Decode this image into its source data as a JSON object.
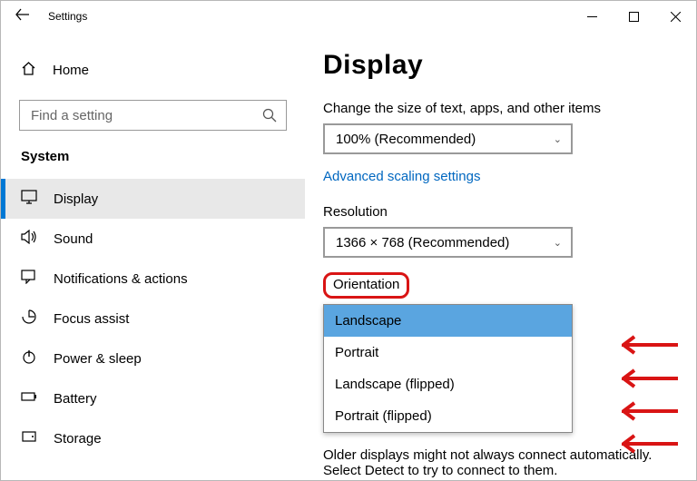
{
  "titlebar": {
    "title": "Settings",
    "back_icon": "back-arrow"
  },
  "sidebar": {
    "home_label": "Home",
    "search_placeholder": "Find a setting",
    "section_title": "System",
    "items": [
      {
        "label": "Display"
      },
      {
        "label": "Sound"
      },
      {
        "label": "Notifications & actions"
      },
      {
        "label": "Focus assist"
      },
      {
        "label": "Power & sleep"
      },
      {
        "label": "Battery"
      },
      {
        "label": "Storage"
      }
    ]
  },
  "main": {
    "title": "Display",
    "scale_label": "Change the size of text, apps, and other items",
    "scale_value": "100% (Recommended)",
    "advanced_link": "Advanced scaling settings",
    "resolution_label": "Resolution",
    "resolution_value": "1366 × 768 (Recommended)",
    "orientation_label": "Orientation",
    "orientation_options": [
      "Landscape",
      "Portrait",
      "Landscape (flipped)",
      "Portrait (flipped)"
    ],
    "foot_text": "Older displays might not always connect automatically. Select Detect to try to connect to them."
  },
  "annotation": {
    "highlight_color": "#d91414"
  }
}
